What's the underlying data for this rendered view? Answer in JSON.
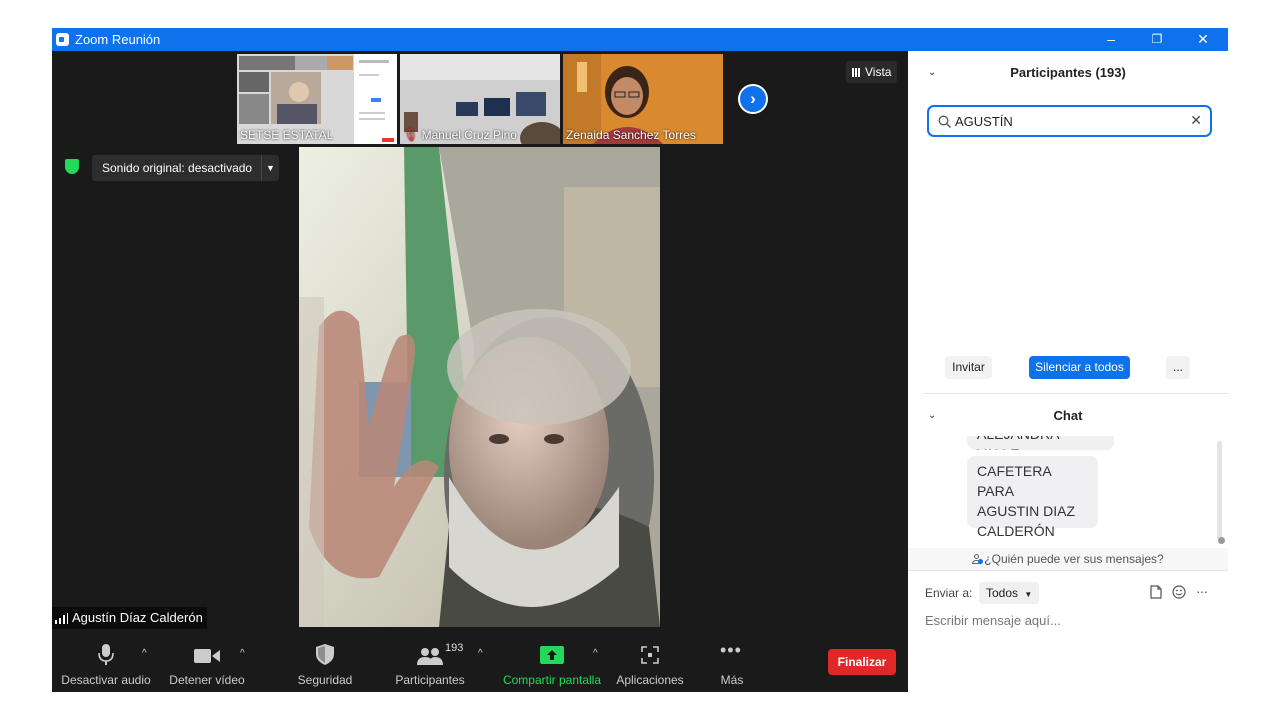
{
  "window": {
    "title": "Zoom Reunión",
    "minimize": "–",
    "restore": "❐",
    "close": "✕"
  },
  "thumbnails": [
    {
      "name": "SETSE ESTATAL"
    },
    {
      "name": "Manuel Cruz Pino"
    },
    {
      "name": "Zenaida Sanchez Torres"
    }
  ],
  "next_button": "›",
  "view_button": "Vista",
  "sound_original": "Sonido original: desactivado",
  "active_speaker": "Agustín Díaz Calderón",
  "toolbar": {
    "audio": "Desactivar audio",
    "video": "Detener vídeo",
    "security": "Seguridad",
    "participants": "Participantes",
    "participants_count": "193",
    "share": "Compartir pantalla",
    "apps": "Aplicaciones",
    "more": "Más",
    "end": "Finalizar"
  },
  "participants_panel": {
    "title": "Participantes (193)",
    "search_value": "AGUSTÍN",
    "invite": "Invitar",
    "mute_all": "Silenciar a todos",
    "more": "..."
  },
  "chat_panel": {
    "title": "Chat",
    "partial_message": "ALEJANDRA VALLE",
    "message_line1": "CAFETERA PARA",
    "message_line2": "AGUSTIN DIAZ",
    "message_line3": "CALDERÓN",
    "who_can_see": "¿Quién puede ver sus mensajes?",
    "send_to_label": "Enviar a:",
    "send_to_value": "Todos",
    "input_placeholder": "Escribir mensaje aquí..."
  },
  "colors": {
    "zoom_blue": "#0e72ed",
    "end_red": "#e02828",
    "share_green": "#23d959",
    "video_bg": "#1a1a1a"
  },
  "icons": [
    "zoom-logo-icon",
    "shield-icon",
    "grid-icon",
    "microphone-icon",
    "camera-icon",
    "security-shield-icon",
    "participants-icon",
    "share-arrow-icon",
    "apps-icon",
    "more-dots-icon",
    "search-icon",
    "clear-icon",
    "file-icon",
    "emoji-icon",
    "ellipsis-icon",
    "person-icon",
    "signal-icon"
  ]
}
